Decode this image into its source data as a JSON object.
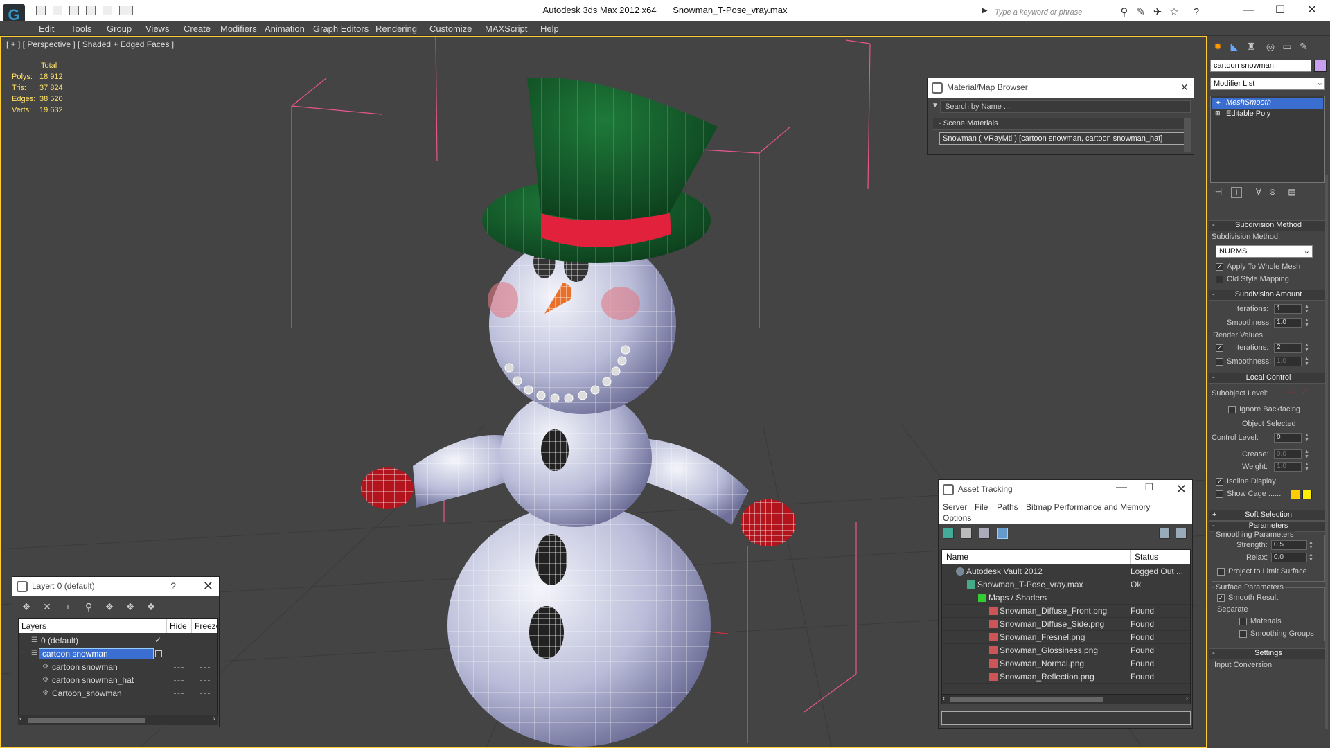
{
  "app": {
    "title": "Autodesk 3ds Max  2012 x64",
    "filename": "Snowman_T-Pose_vray.max",
    "search_placeholder": "Type a keyword or phrase"
  },
  "menu": [
    "Edit",
    "Tools",
    "Group",
    "Views",
    "Create",
    "Modifiers",
    "Animation",
    "Graph Editors",
    "Rendering",
    "Customize",
    "MAXScript",
    "Help"
  ],
  "viewport": {
    "label": "[ + ] [ Perspective ] [ Shaded + Edged Faces ]",
    "stats": {
      "header": "Total",
      "rows": [
        {
          "k": "Polys:",
          "v": "18 912"
        },
        {
          "k": "Tris:",
          "v": "37 824"
        },
        {
          "k": "Edges:",
          "v": "38 520"
        },
        {
          "k": "Verts:",
          "v": "19 632"
        }
      ]
    }
  },
  "material_browser": {
    "title": "Material/Map Browser",
    "search": "Search by Name ...",
    "section": "Scene Materials",
    "item": "Snowman  ( VRayMtl )  [cartoon snowman, cartoon snowman_hat]"
  },
  "asset_tracking": {
    "title": "Asset Tracking",
    "menu": [
      "Server",
      "File",
      "Paths",
      "Bitmap Performance and Memory"
    ],
    "menu2": "Options",
    "columns": [
      "Name",
      "Status"
    ],
    "rows": [
      {
        "name": "Autodesk Vault 2012",
        "status": "Logged Out ...",
        "indent": 0,
        "icon": "vault"
      },
      {
        "name": "Snowman_T-Pose_vray.max",
        "status": "Ok",
        "indent": 1,
        "icon": "max"
      },
      {
        "name": "Maps / Shaders",
        "status": "",
        "indent": 2,
        "icon": "folder"
      },
      {
        "name": "Snowman_Diffuse_Front.png",
        "status": "Found",
        "indent": 3,
        "icon": "png"
      },
      {
        "name": "Snowman_Diffuse_Side.png",
        "status": "Found",
        "indent": 3,
        "icon": "png"
      },
      {
        "name": "Snowman_Fresnel.png",
        "status": "Found",
        "indent": 3,
        "icon": "png"
      },
      {
        "name": "Snowman_Glossiness.png",
        "status": "Found",
        "indent": 3,
        "icon": "png"
      },
      {
        "name": "Snowman_Normal.png",
        "status": "Found",
        "indent": 3,
        "icon": "png"
      },
      {
        "name": "Snowman_Reflection.png",
        "status": "Found",
        "indent": 3,
        "icon": "png"
      }
    ]
  },
  "layers": {
    "title": "Layer: 0 (default)",
    "help": "?",
    "columns": [
      "Layers",
      "Hide",
      "Freeze"
    ],
    "rows": [
      {
        "name": "0 (default)",
        "indent": 0,
        "selected": false
      },
      {
        "name": "cartoon snowman",
        "indent": 0,
        "selected": true
      },
      {
        "name": "cartoon snowman",
        "indent": 1,
        "selected": false
      },
      {
        "name": "cartoon snowman_hat",
        "indent": 1,
        "selected": false
      },
      {
        "name": "Cartoon_snowman",
        "indent": 1,
        "selected": false
      }
    ]
  },
  "command_panel": {
    "object_name": "cartoon snowman",
    "object_color": "#c9a0ef",
    "modifier_list": "Modifier List",
    "stack": [
      "MeshSmooth",
      "Editable Poly"
    ],
    "subdivision_method": {
      "title": "Subdivision Method",
      "label": "Subdivision Method:",
      "value": "NURMS",
      "apply_whole_mesh": "Apply To Whole Mesh",
      "old_style": "Old Style Mapping"
    },
    "subdivision_amount": {
      "title": "Subdivision Amount",
      "iterations_label": "Iterations:",
      "iterations": "1",
      "smoothness_label": "Smoothness:",
      "smoothness": "1.0",
      "render_values": "Render Values:",
      "r_iterations_label": "Iterations:",
      "r_iterations": "2",
      "r_smoothness_label": "Smoothness:",
      "r_smoothness": "1.0"
    },
    "local_control": {
      "title": "Local Control",
      "subobject": "Subobject Level:",
      "ignore_backfacing": "Ignore Backfacing",
      "object_selected": "Object Selected",
      "control_level_label": "Control Level:",
      "control_level": "0",
      "crease_label": "Crease:",
      "crease": "0.0",
      "weight_label": "Weight:",
      "weight": "1.0",
      "isoline": "Isoline Display",
      "show_cage": "Show Cage ......"
    },
    "soft_selection": "Soft Selection",
    "parameters": {
      "title": "Parameters",
      "smoothing_params": "Smoothing Parameters",
      "strength_label": "Strength:",
      "strength": "0.5",
      "relax_label": "Relax:",
      "relax": "0.0",
      "project": "Project to Limit Surface",
      "surface_params": "Surface Parameters",
      "smooth_result": "Smooth Result",
      "separate": "Separate",
      "materials": "Materials",
      "smoothing_groups": "Smoothing Groups"
    },
    "settings": "Settings",
    "input_conversion": "Input Conversion"
  },
  "colors": {
    "accent": "#ffcc33",
    "selection": "#3a6fd1",
    "cage1": "#ffcc00",
    "cage2": "#ffee00"
  }
}
